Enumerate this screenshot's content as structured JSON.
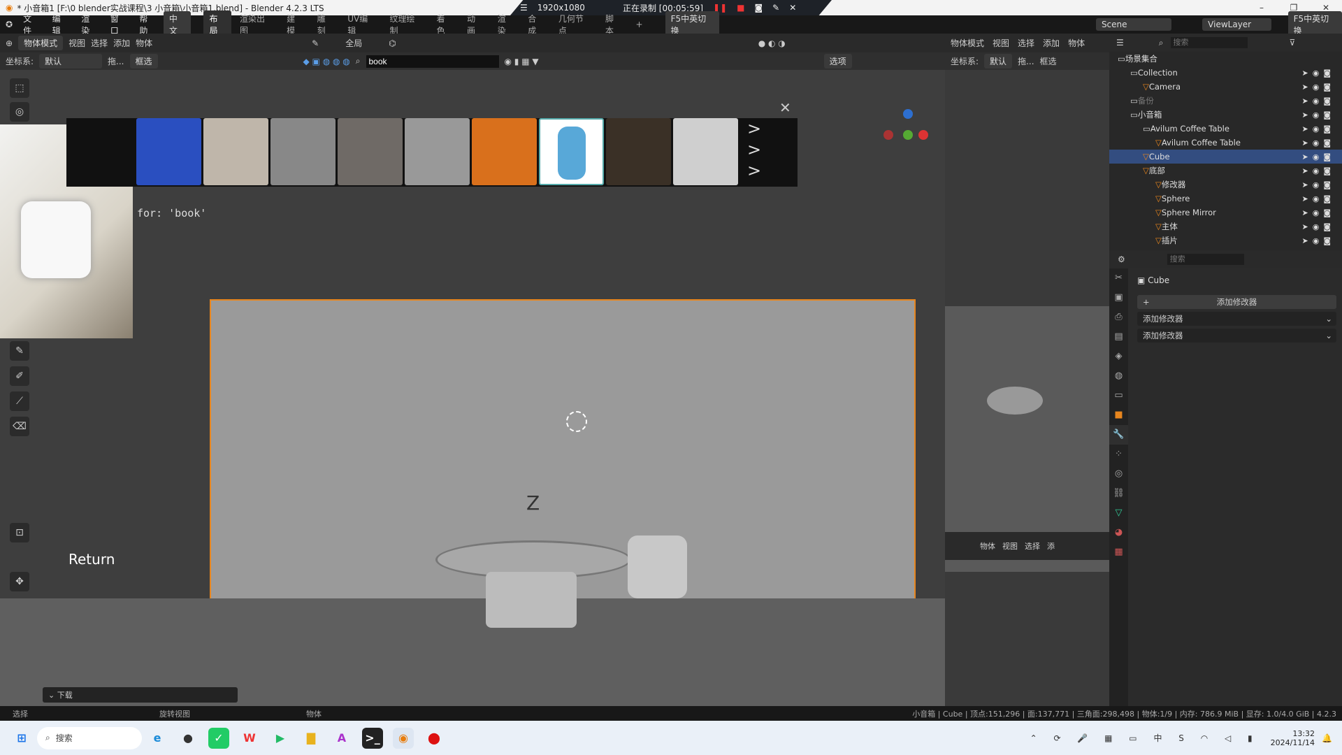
{
  "window": {
    "title": "* 小音箱1 [F:\\0 blender实战课程\\3 小音箱\\小音箱1.blend] - Blender 4.2.3 LTS"
  },
  "recorder": {
    "resolution": "1920x1080",
    "status": "正在录制 [00:05:59]"
  },
  "menu": {
    "items": [
      "文件",
      "编辑",
      "渲染",
      "窗口",
      "帮助"
    ],
    "lang": "中文",
    "workspaces": [
      "布局",
      "渲染出图",
      "建模",
      "雕刻",
      "UV编辑",
      "纹理绘制",
      "着色",
      "动画",
      "渲染",
      "合成",
      "几何节点",
      "脚本"
    ],
    "add": "+",
    "ime": "F5中英切换",
    "scene": "Scene",
    "viewlayer": "ViewLayer"
  },
  "viewport": {
    "mode": "物体模式",
    "menus": [
      "视图",
      "选择",
      "添加",
      "物体"
    ],
    "transform": "全局",
    "coord_label": "坐标系:",
    "coord_value": "默认",
    "drag": "拖...",
    "select": "框选",
    "search": "book",
    "options": "选项",
    "search_result": "for: 'book'",
    "return_label": "Return",
    "panel": "下载"
  },
  "right_viewport": {
    "mode": "物体模式",
    "menus": [
      "视图",
      "选择",
      "添加",
      "物体"
    ],
    "coord_label": "坐标系:",
    "coord_value": "默认",
    "drag": "拖...",
    "select": "框选",
    "footer_mode": "物体",
    "footer_menus": [
      "视图",
      "选择",
      "添"
    ]
  },
  "outliner": {
    "search_placeholder": "搜索",
    "rows": [
      {
        "label": "场景集合",
        "depth": 0
      },
      {
        "label": "Collection",
        "depth": 1
      },
      {
        "label": "Camera",
        "depth": 2
      },
      {
        "label": "备份",
        "depth": 1,
        "disabled": true
      },
      {
        "label": "小音箱",
        "depth": 1
      },
      {
        "label": "Avilum Coffee Table",
        "depth": 2
      },
      {
        "label": "Avilum Coffee Table",
        "depth": 3
      },
      {
        "label": "Cube",
        "depth": 2,
        "selected": true
      },
      {
        "label": "底部",
        "depth": 2
      },
      {
        "label": "修改器",
        "depth": 3
      },
      {
        "label": "Sphere",
        "depth": 3
      },
      {
        "label": "Sphere Mirror",
        "depth": 3
      },
      {
        "label": "主体",
        "depth": 3
      },
      {
        "label": "插片",
        "depth": 3
      }
    ]
  },
  "properties": {
    "search_placeholder": "搜索",
    "object": "Cube",
    "add_modifier": "添加修改器",
    "dropdowns": [
      "添加修改器",
      "添加修改器"
    ]
  },
  "statusbar": {
    "left": [
      "选择",
      "旋转视图",
      "物体"
    ],
    "right": "小音箱 | Cube | 顶点:151,296 | 面:137,771 | 三角面:298,498 | 物体:1/9 | 内存: 786.9 MiB | 显存: 1.0/4.0 GiB | 4.2.3"
  },
  "taskbar": {
    "search": "搜索",
    "time": "13:32",
    "date": "2024/11/14"
  },
  "colors": {
    "accent": "#334d80",
    "selection_outline": "#e8861e"
  }
}
